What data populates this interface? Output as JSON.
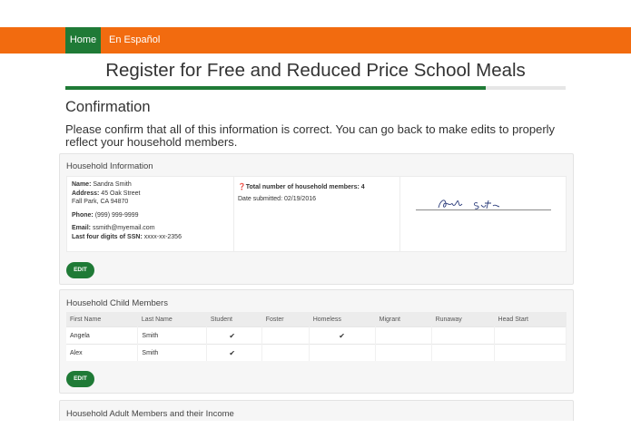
{
  "nav": {
    "home": "Home",
    "spanish": "En Español"
  },
  "page_title": "Register for Free and Reduced Price School Meals",
  "progress": 0.84,
  "confirmation": {
    "heading": "Confirmation",
    "intro": "Please confirm that all of this information is correct. You can go back to make edits to properly reflect your household members."
  },
  "household_info": {
    "heading": "Household Information",
    "name_label": "Name:",
    "name": "Sandra Smith",
    "address_label": "Address:",
    "address_line1": "45 Oak Street",
    "address_line2": "Fall Park, CA 94870",
    "phone_label": "Phone:",
    "phone": "(999) 999-9999",
    "email_label": "Email:",
    "email": "ssmith@myemail.com",
    "ssn_label": "Last four digits of SSN:",
    "ssn": "xxxx-xx-2356",
    "total_members": "Total number of household members: 4",
    "date_submitted": "Date submitted: 02/19/2016",
    "edit": "EDIT"
  },
  "child_members": {
    "heading": "Household Child Members",
    "columns": [
      "First Name",
      "Last Name",
      "Student",
      "Foster",
      "Homeless",
      "Migrant",
      "Runaway",
      "Head Start"
    ],
    "rows": [
      {
        "first": "Angela",
        "last": "Smith",
        "student": "✔",
        "foster": "",
        "homeless": "✔",
        "migrant": "",
        "runaway": "",
        "head_start": ""
      },
      {
        "first": "Alex",
        "last": "Smith",
        "student": "✔",
        "foster": "",
        "homeless": "",
        "migrant": "",
        "runaway": "",
        "head_start": ""
      }
    ],
    "edit": "EDIT"
  },
  "adult_members": {
    "heading": "Household Adult Members and their Income"
  }
}
